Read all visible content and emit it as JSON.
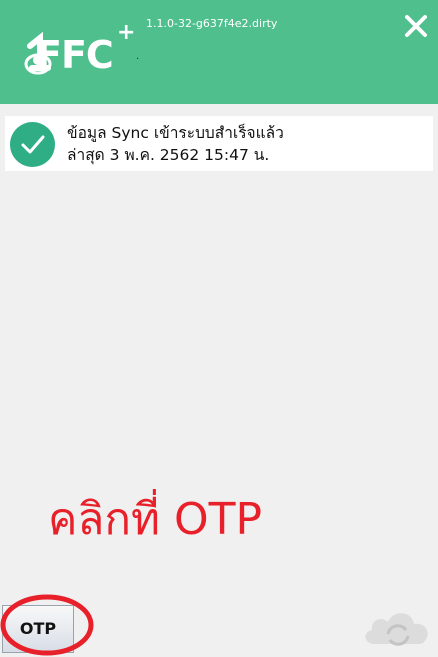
{
  "app": {
    "logo_text": "FFC",
    "logo_plus": "+",
    "logo_dot": ".",
    "version": "1.1.0-32-g637f4e2.dirty"
  },
  "status": {
    "line1": "ข้อมูล Sync เข้าระบบสำเร็จแล้ว",
    "line2": "ล่าสุด 3 พ.ค. 2562 15:47 น."
  },
  "annotation": {
    "text": "คลิกที่ OTP",
    "color": "#e8202a"
  },
  "buttons": {
    "otp_label": "OTP"
  },
  "icons": {
    "close": "close-icon",
    "check": "check-icon",
    "cloud": "cloud-sync-icon"
  },
  "colors": {
    "header": "#4fc08d",
    "check": "#2fae86"
  }
}
